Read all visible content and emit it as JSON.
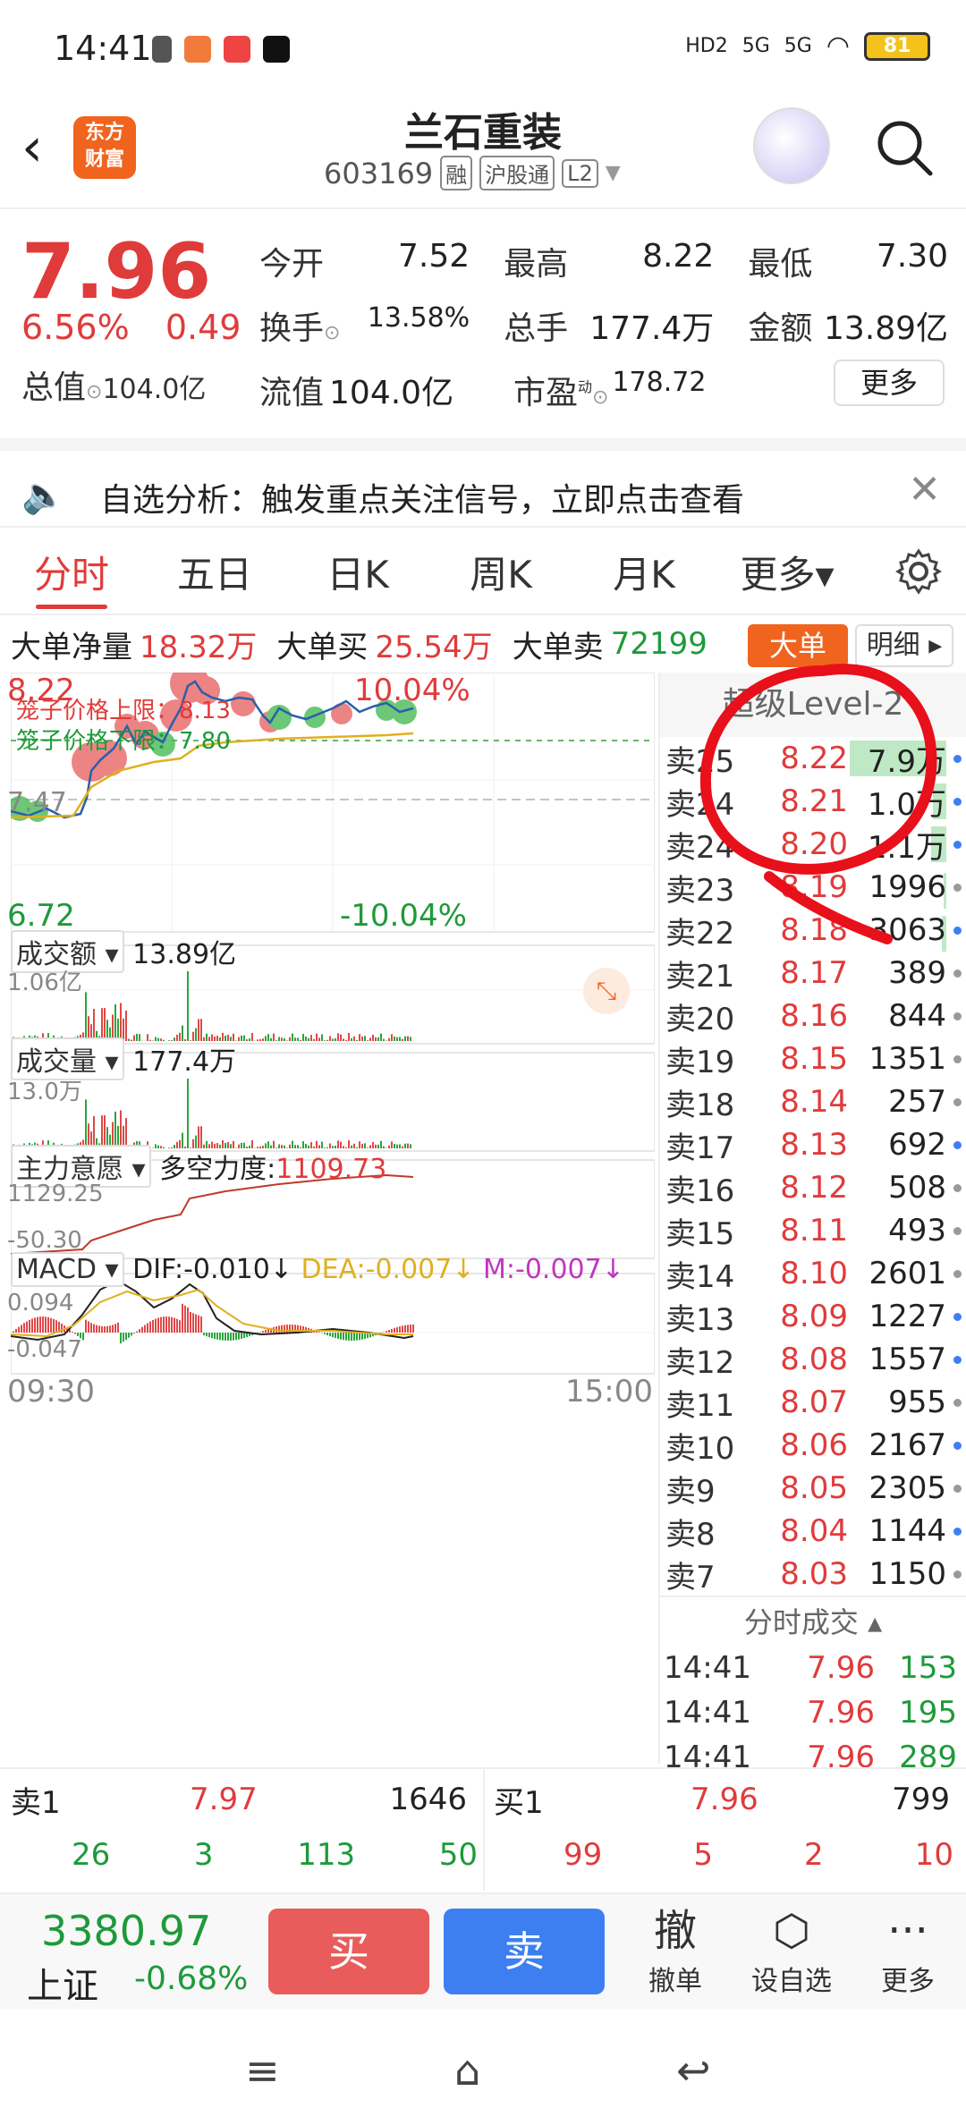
{
  "status": {
    "time": "14:41",
    "battery": "81",
    "net1": "HD2",
    "net2": "5G",
    "net3": "5G"
  },
  "header": {
    "title": "兰石重装",
    "code": "603169",
    "tags": [
      "融",
      "沪股通",
      "L2"
    ],
    "logo_text": "东方\n财富"
  },
  "quote": {
    "price": "7.96",
    "change_pct": "6.56%",
    "change_abs": "0.49",
    "total_cap_label": "总值",
    "total_cap": "104.0亿",
    "open_label": "今开",
    "open": "7.52",
    "high_label": "最高",
    "high": "8.22",
    "low_label": "最低",
    "low": "7.30",
    "turnover_label": "换手",
    "turnover": "13.58%",
    "volume_label": "总手",
    "volume": "177.4万",
    "amount_label": "金额",
    "amount": "13.89亿",
    "float_cap_label": "流值",
    "float_cap": "104.0亿",
    "pe_label": "市盈",
    "pe_sup": "动",
    "pe": "178.72",
    "more_label": "更多"
  },
  "notice": {
    "text": "自选分析：触发重点关注信号，立即点击查看"
  },
  "tabs": [
    "分时",
    "五日",
    "日K",
    "周K",
    "月K",
    "更多▾"
  ],
  "big_order": {
    "net_label": "大单净量",
    "net": "18.32万",
    "buy_label": "大单买",
    "buy": "25.54万",
    "sell_label": "大单卖",
    "sell": "72199",
    "btn_big": "大单",
    "btn_detail": "明细"
  },
  "chart_labels": {
    "price_top": "8.22",
    "pct_top": "10.04%",
    "cage_upper": "笼子价格上限：8.13",
    "cage_lower": "笼子价格下限：7.80",
    "mid_price": "7.47",
    "price_bottom": "6.72",
    "pct_bottom": "-10.04%",
    "amount_dd": "成交额",
    "amount_val": "13.89亿",
    "amount_max": "1.06亿",
    "volume_dd": "成交量",
    "volume_val": "177.4万",
    "volume_max": "13.0万",
    "intent_dd": "主力意愿",
    "intent_label": "多空力度:",
    "intent_val": "1109.73",
    "intent_max": "1129.25",
    "intent_min": "-50.30",
    "macd_dd": "MACD",
    "dif": "DIF:-0.010↓",
    "dea": "DEA:-0.007↓",
    "m": "M:-0.007↓",
    "macd_max": "0.094",
    "macd_min": "-0.047",
    "time_start": "09:30",
    "time_end": "15:00"
  },
  "book": {
    "header": "超级Level-2",
    "rows": [
      {
        "l": "卖25",
        "p": "8.22",
        "q": "7.9万",
        "bar": 70,
        "dot": "#3d7ff0"
      },
      {
        "l": "卖24",
        "p": "8.21",
        "q": "1.0万",
        "bar": 10,
        "dot": "#3d7ff0"
      },
      {
        "l": "卖24",
        "p": "8.20",
        "q": "1.1万",
        "bar": 11,
        "dot": "#3d7ff0"
      },
      {
        "l": "卖23",
        "p": "8.19",
        "q": "1996",
        "bar": 2,
        "dot": "#999"
      },
      {
        "l": "卖22",
        "p": "8.18",
        "q": "3063",
        "bar": 3,
        "dot": "#3d7ff0"
      },
      {
        "l": "卖21",
        "p": "8.17",
        "q": "389",
        "bar": 0,
        "dot": "#999"
      },
      {
        "l": "卖20",
        "p": "8.16",
        "q": "844",
        "bar": 0,
        "dot": "#999"
      },
      {
        "l": "卖19",
        "p": "8.15",
        "q": "1351",
        "bar": 0,
        "dot": "#999"
      },
      {
        "l": "卖18",
        "p": "8.14",
        "q": "257",
        "bar": 0,
        "dot": "#999"
      },
      {
        "l": "卖17",
        "p": "8.13",
        "q": "692",
        "bar": 0,
        "dot": "#3d7ff0"
      },
      {
        "l": "卖16",
        "p": "8.12",
        "q": "508",
        "bar": 0,
        "dot": "#999"
      },
      {
        "l": "卖15",
        "p": "8.11",
        "q": "493",
        "bar": 0,
        "dot": "#999"
      },
      {
        "l": "卖14",
        "p": "8.10",
        "q": "2601",
        "bar": 0,
        "dot": "#999"
      },
      {
        "l": "卖13",
        "p": "8.09",
        "q": "1227",
        "bar": 0,
        "dot": "#3d7ff0"
      },
      {
        "l": "卖12",
        "p": "8.08",
        "q": "1557",
        "bar": 0,
        "dot": "#3d7ff0"
      },
      {
        "l": "卖11",
        "p": "8.07",
        "q": "955",
        "bar": 0,
        "dot": "#999"
      },
      {
        "l": "卖10",
        "p": "8.06",
        "q": "2167",
        "bar": 0,
        "dot": "#3d7ff0"
      },
      {
        "l": "卖9",
        "p": "8.05",
        "q": "2305",
        "bar": 0,
        "dot": "#999"
      },
      {
        "l": "卖8",
        "p": "8.04",
        "q": "1144",
        "bar": 0,
        "dot": "#3d7ff0"
      },
      {
        "l": "卖7",
        "p": "8.03",
        "q": "1150",
        "bar": 0,
        "dot": "#999"
      }
    ],
    "ticks_header": "分时成交",
    "ticks": [
      {
        "t": "14:41",
        "p": "7.96",
        "v": "153"
      },
      {
        "t": "14:41",
        "p": "7.96",
        "v": "195"
      },
      {
        "t": "14:41",
        "p": "7.96",
        "v": "289"
      }
    ]
  },
  "level1": {
    "sell_label": "卖1",
    "sell_price": "7.97",
    "sell_qty": "1646",
    "buy_label": "买1",
    "buy_price": "7.96",
    "buy_qty": "799",
    "sell_sub": [
      "26",
      "3",
      "113",
      "50"
    ],
    "buy_sub": [
      "99",
      "5",
      "2",
      "10"
    ]
  },
  "trade": {
    "index_value": "3380.97",
    "index_name": "上证",
    "index_change": "-0.68%",
    "buy": "买",
    "sell": "卖",
    "cancel_icon": "撤",
    "cancel": "撤单",
    "watch": "设自选",
    "more": "更多"
  }
}
